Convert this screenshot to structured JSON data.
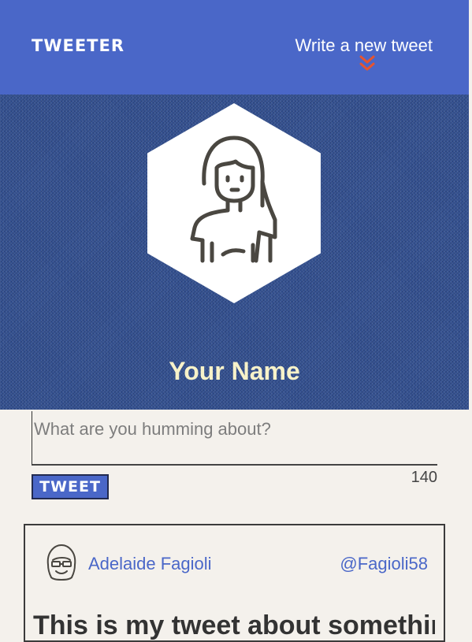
{
  "nav": {
    "brand": "TWEETER",
    "compose_link": "Write a new tweet",
    "compose_icon": "double-chevron-down-icon",
    "accent_color": "#e8542e"
  },
  "profile": {
    "name": "Your Name",
    "avatar_icon": "woman-avatar-icon"
  },
  "composer": {
    "placeholder": "What are you humming about?",
    "value": "",
    "button_label": "TWEET",
    "char_count": "140"
  },
  "tweets": [
    {
      "author": "Adelaide Fagioli",
      "handle": "@Fagioli58",
      "avatar_icon": "girl-with-glasses-avatar-icon",
      "text": "This is my tweet about something"
    }
  ],
  "colors": {
    "header_blue": "#4a67c8",
    "hero_denim": "#33508f",
    "name_cream": "#f7f2c9",
    "page_background": "#f4f1ec"
  }
}
